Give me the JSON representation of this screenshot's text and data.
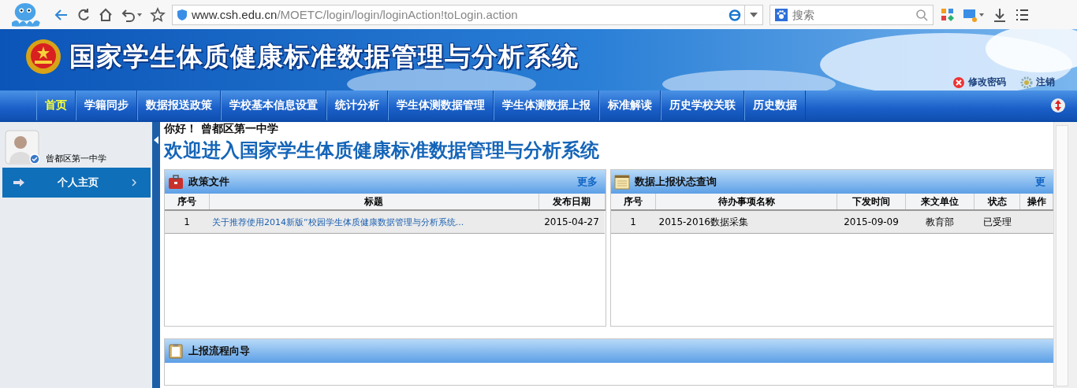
{
  "browser": {
    "url_host": "www.csh.edu.cn",
    "url_path": "/MOETC/login/login/loginAction!toLogin.action",
    "search_placeholder": "搜索"
  },
  "header": {
    "title": "国家学生体质健康标准数据管理与分析系统",
    "links": [
      {
        "kind": "password",
        "label": "修改密码"
      },
      {
        "kind": "logout",
        "label": "注销"
      }
    ]
  },
  "nav": [
    {
      "label": "首页",
      "selected": true
    },
    {
      "label": "学籍同步",
      "selected": false
    },
    {
      "label": "数据报送政策",
      "selected": false
    },
    {
      "label": "学校基本信息设置",
      "selected": false
    },
    {
      "label": "统计分析",
      "selected": false
    },
    {
      "label": "学生体测数据管理",
      "selected": false
    },
    {
      "label": "学生体测数据上报",
      "selected": false
    },
    {
      "label": "标准解读",
      "selected": false
    },
    {
      "label": "历史学校关联",
      "selected": false
    },
    {
      "label": "历史数据",
      "selected": false
    }
  ],
  "sidebar": {
    "user": "曾都区第一中学",
    "items": [
      {
        "label": "个人主页",
        "selected": true
      }
    ]
  },
  "greeting": "你好！ 曾都区第一中学",
  "welcome": "欢迎进入国家学生体质健康标准数据管理与分析系统",
  "policy_panel": {
    "title": "政策文件",
    "more": "更多",
    "columns": [
      "序号",
      "标题",
      "发布日期"
    ],
    "rows": [
      [
        "1",
        "关于推荐使用2014新版“校园学生体质健康数据管理与分析系统...",
        "2015-04-27"
      ]
    ]
  },
  "status_panel": {
    "title": "数据上报状态查询",
    "more": "更",
    "columns": [
      "序号",
      "待办事项名称",
      "下发时间",
      "来文单位",
      "状态",
      "操作"
    ],
    "rows": [
      [
        "1",
        "2015-2016数据采集",
        "2015-09-09",
        "教育部",
        "已受理",
        ""
      ]
    ]
  },
  "guide_panel": {
    "title": "上报流程向导"
  }
}
